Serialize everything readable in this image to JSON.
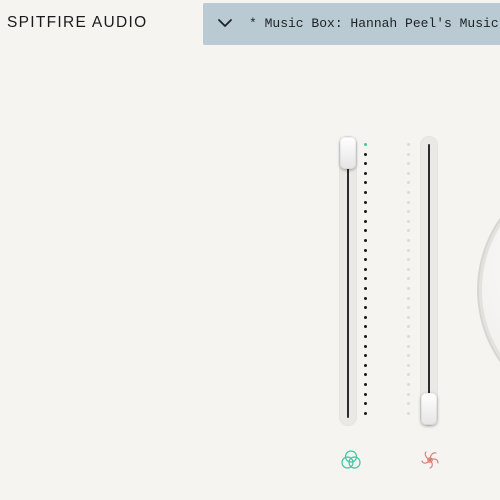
{
  "header": {
    "brand": "SPITFIRE AUDIO",
    "preset_name": "* Music Box: Hannah Peel's Music Box"
  },
  "icons": {
    "preset_dropdown": "chevron-down-icon",
    "close_mic": "venn-triad-icon",
    "ambient_mic": "spiral-flower-icon"
  },
  "sliders": {
    "close_mic_level": 1.0,
    "ambient_mic_level": 0.0
  },
  "colors": {
    "background": "#f6f4f1",
    "preset_bar": "#b9cad2",
    "close_mic_accent": "#3fc8a3",
    "ambient_mic_accent": "#d9786d"
  }
}
